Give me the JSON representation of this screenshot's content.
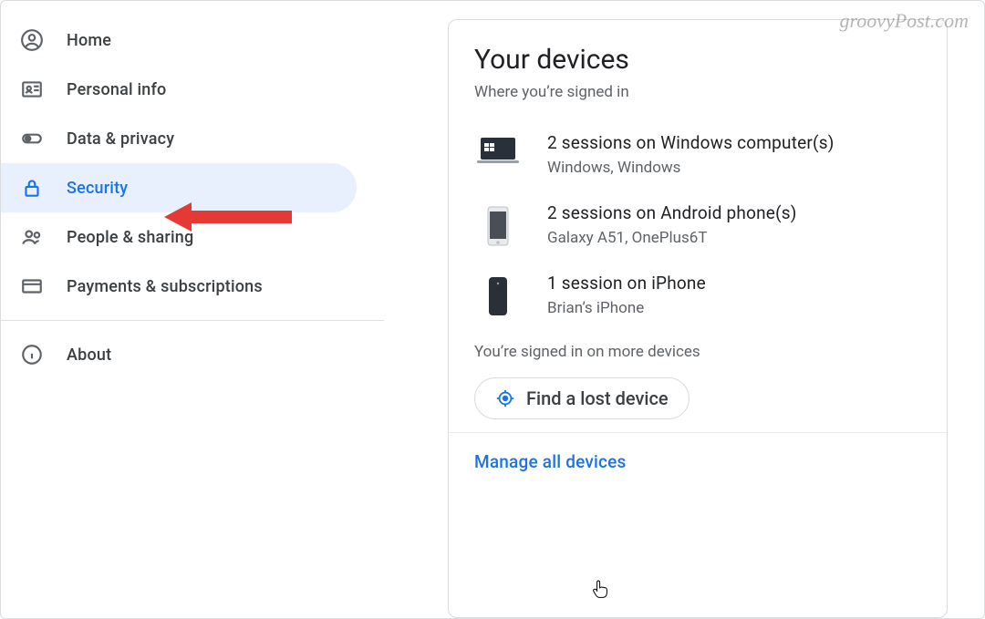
{
  "watermark": "groovyPost.com",
  "sidebar": {
    "items": [
      {
        "label": "Home"
      },
      {
        "label": "Personal info"
      },
      {
        "label": "Data & privacy"
      },
      {
        "label": "Security"
      },
      {
        "label": "People & sharing"
      },
      {
        "label": "Payments & subscriptions"
      },
      {
        "label": "About"
      }
    ],
    "active_index": 3
  },
  "card": {
    "title": "Your devices",
    "subtitle": "Where you’re signed in",
    "devices": [
      {
        "title": "2 sessions on Windows computer(s)",
        "sub": "Windows, Windows"
      },
      {
        "title": "2 sessions on Android phone(s)",
        "sub": "Galaxy A51, OnePlus6T"
      },
      {
        "title": "1 session on iPhone",
        "sub": "Brian’s iPhone"
      }
    ],
    "more_note": "You’re signed in on more devices",
    "find_label": "Find a lost device",
    "manage_label": "Manage all devices"
  },
  "colors": {
    "accent": "#1a73e8",
    "muted": "#5f6368",
    "border": "#dadce0",
    "selected_bg": "#e8f0fe",
    "arrow": "#e53935"
  }
}
